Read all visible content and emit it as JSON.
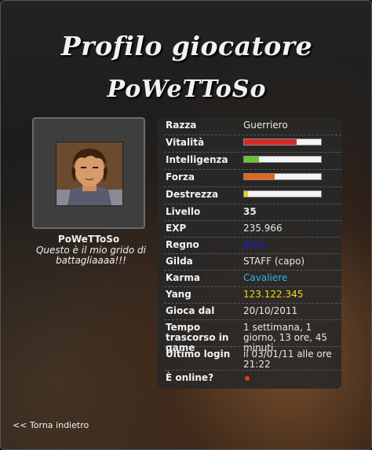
{
  "header": {
    "title": "Profilo giocatore",
    "player_name": "PoWeTToSo"
  },
  "avatar": {
    "name": "PoWeTToSo",
    "shout": "Questo è il mio grido di battagliaaaa!!!"
  },
  "stats": {
    "razza": {
      "label": "Razza",
      "value": "Guerriero"
    },
    "vitalita": {
      "label": "Vitalità",
      "fraction": 0.68,
      "color": "#d42a2a"
    },
    "intelligenza": {
      "label": "Intelligenza",
      "fraction": 0.19,
      "color": "#68c23a"
    },
    "forza": {
      "label": "Forza",
      "fraction": 0.4,
      "color": "#e0661e"
    },
    "destrezza": {
      "label": "Destrezza",
      "fraction": 0.05,
      "color": "#e6cf1e"
    },
    "livello": {
      "label": "Livello",
      "value": "35"
    },
    "exp": {
      "label": "EXP",
      "value": "235.966"
    },
    "regno": {
      "label": "Regno",
      "value": "Jinno",
      "color": "#1a1ad8"
    },
    "gilda": {
      "label": "Gilda",
      "value": "STAFF (capo)"
    },
    "karma": {
      "label": "Karma",
      "value": "Cavaliere",
      "color": "#2bb8e8"
    },
    "yang": {
      "label": "Yang",
      "value": "123.122.345",
      "color": "#f2d81a"
    },
    "gioca_dal": {
      "label": "Gioca dal",
      "value": "20/10/2011"
    },
    "tempo": {
      "label": "Tempo trascorso in game",
      "value": "1 settimana, 1 giorno, 13 ore, 45 minuti"
    },
    "ultimo_login": {
      "label": "Ultimo login",
      "value": "il 03/01/11 alle ore 21:22"
    },
    "online": {
      "label": "È online?",
      "status_color": "#e03a1a"
    }
  },
  "footer": {
    "back_label": "<< Torna indietro"
  }
}
